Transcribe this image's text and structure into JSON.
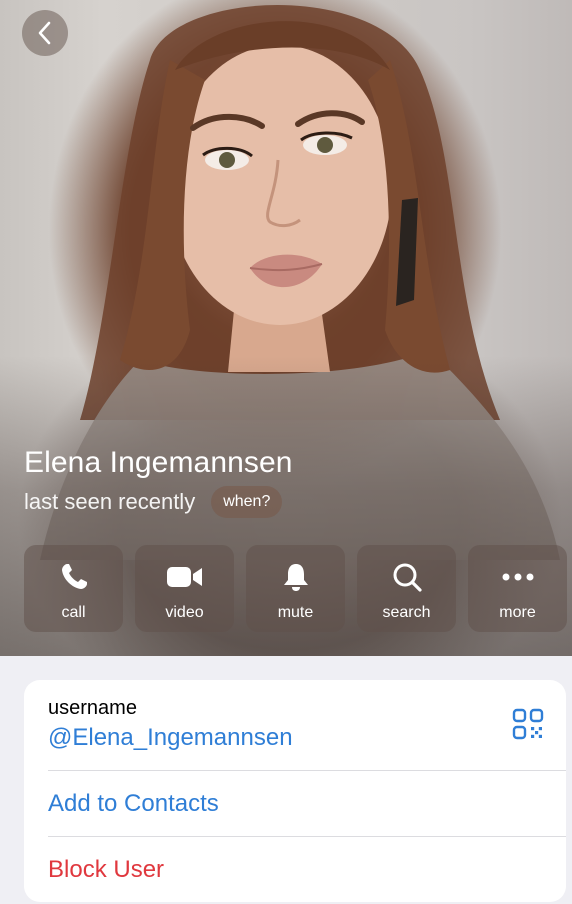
{
  "profile": {
    "name": "Elena Ingemannsen",
    "status": "last seen recently",
    "when_badge": "when?"
  },
  "actions": [
    {
      "label": "call",
      "icon": "phone-icon"
    },
    {
      "label": "video",
      "icon": "video-camera-icon"
    },
    {
      "label": "mute",
      "icon": "bell-icon"
    },
    {
      "label": "search",
      "icon": "search-icon"
    },
    {
      "label": "more",
      "icon": "more-dots-icon"
    }
  ],
  "info": {
    "username_label": "username",
    "username_value": "@Elena_Ingemannsen",
    "add_contact": "Add to Contacts",
    "block_user": "Block User"
  },
  "colors": {
    "link": "#2f7ed6",
    "destructive": "#e0383e",
    "background": "#efeff4"
  }
}
